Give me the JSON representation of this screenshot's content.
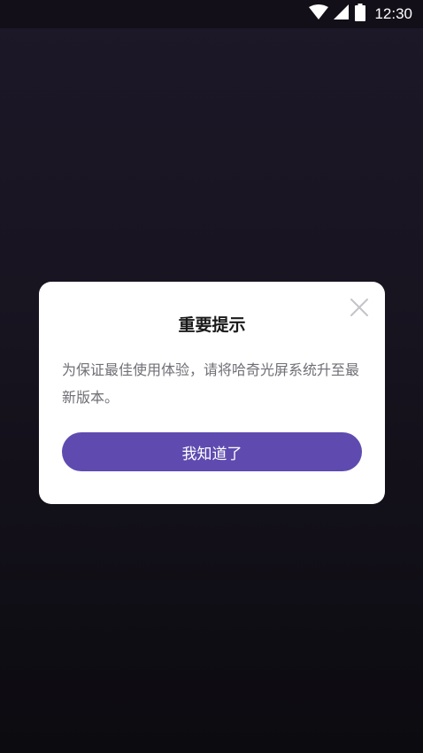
{
  "status_bar": {
    "time": "12:30",
    "icons": [
      "wifi-icon",
      "signal-icon",
      "battery-icon"
    ]
  },
  "dialog": {
    "title": "重要提示",
    "message": "为保证最佳使用体验，请将哈奇光屏系统升至最新版本。",
    "confirm_label": "我知道了",
    "close_icon": "close-icon"
  },
  "colors": {
    "background_top": "#1c1828",
    "background_bottom": "#0c0b10",
    "dialog_bg": "#ffffff",
    "title": "#1a1a1a",
    "message": "#6f6f76",
    "button_bg": "#5f4bb0",
    "button_text": "#ffffff",
    "close_icon": "#c4c4c8"
  }
}
